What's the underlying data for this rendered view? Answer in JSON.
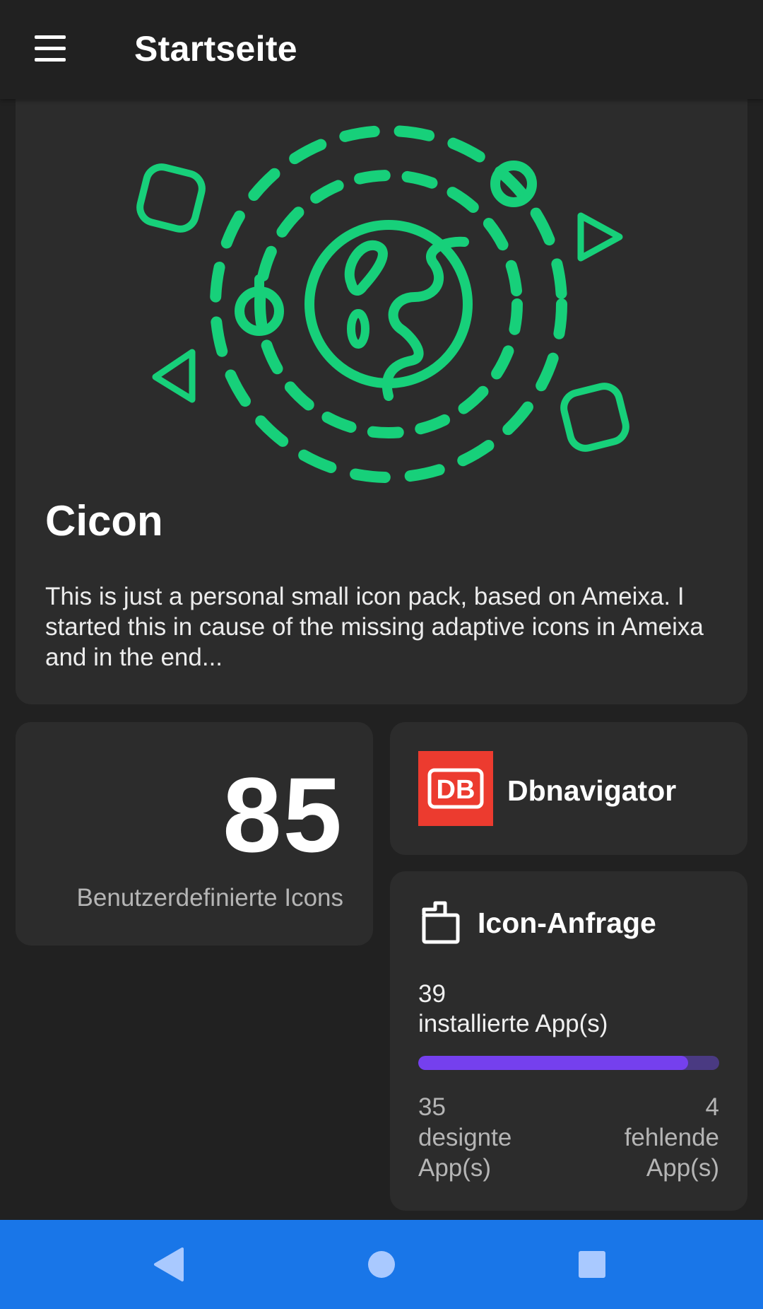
{
  "topbar": {
    "title": "Startseite",
    "menu_icon": "hamburger-menu-icon"
  },
  "hero": {
    "title": "Cicon",
    "description": "This is just a personal small icon pack, based on Ameixa. I started this in cause of the missing adaptive icons in Ameixa and in the end...",
    "illustration_icon": "globe-orbit-illustration",
    "accent_color": "#17d07a"
  },
  "custom_icons": {
    "count": "85",
    "label": "Benutzerdefinierte Icons"
  },
  "featured_app": {
    "name": "Dbnavigator",
    "logo_text": "DB",
    "logo_color": "#ec3b2f"
  },
  "icon_request": {
    "title": "Icon-Anfrage",
    "icon": "request-folder-icon",
    "installed_count": "39",
    "installed_label": "installierte App(s)",
    "progress_fraction": 0.897,
    "themed_count": "35",
    "themed_label_line1": "designte",
    "themed_label_line2": "App(s)",
    "missing_count": "4",
    "missing_label_line1": "fehlende",
    "missing_label_line2": "App(s)",
    "progress_color": "#7540ee",
    "track_color": "#4a3a82"
  },
  "navigation": {
    "back_icon": "back-triangle-icon",
    "home_icon": "home-circle-icon",
    "recents_icon": "recents-square-icon",
    "bar_color": "#1976e8"
  }
}
